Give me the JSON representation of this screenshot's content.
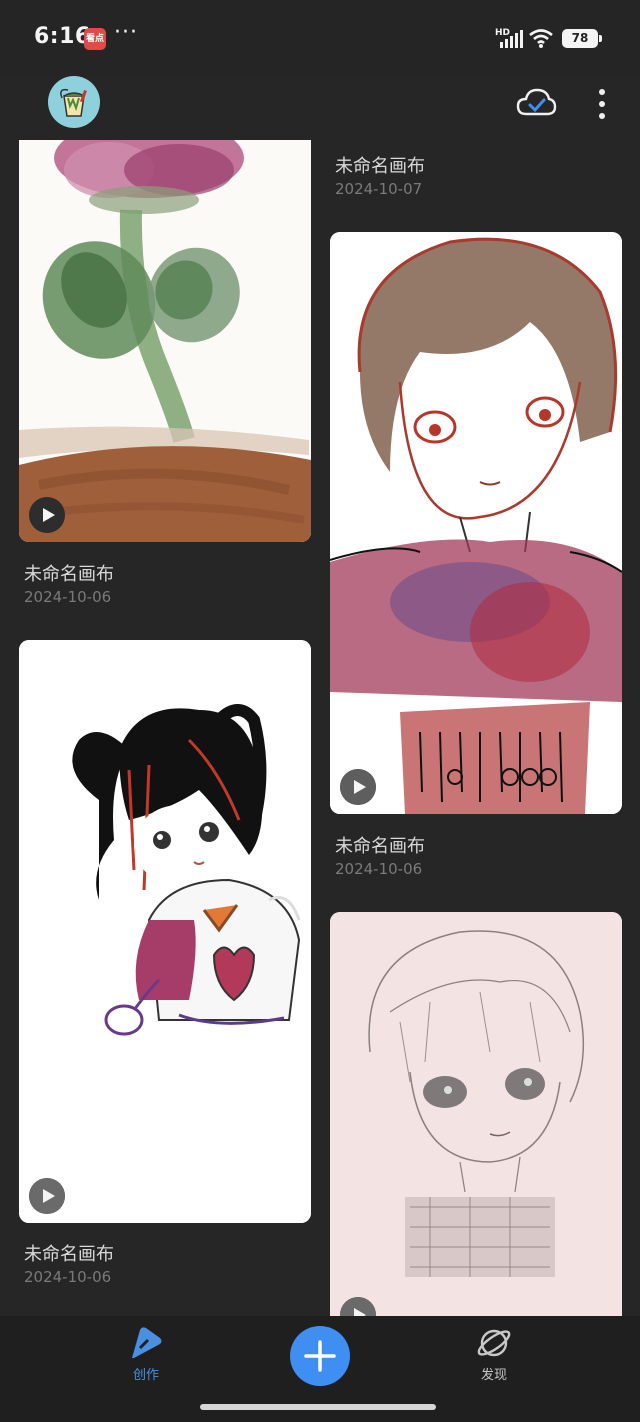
{
  "status_bar": {
    "time": "6:16",
    "app_badge": "看点",
    "more": "···",
    "network": "HD",
    "battery": "78"
  },
  "header": {
    "avatar": "avatar-paint-bucket",
    "cloud_icon": "cloud-sync-check-icon",
    "menu_icon": "more-vertical-icon"
  },
  "artworks": [
    {
      "name": "未命名画布",
      "date": "2024-10-07",
      "thumbnail": "partially-scrolled"
    },
    {
      "name": "未命名画布",
      "date": "2024-10-06",
      "thumbnail": "flower-watercolor"
    },
    {
      "name": "未命名画布",
      "date": "2024-10-06",
      "thumbnail": "boy-brown-hair-watercolor"
    },
    {
      "name": "未命名画布",
      "date": "2024-10-06",
      "thumbnail": "girl-ponytails-heart-shirt"
    },
    {
      "name": "",
      "date": "",
      "thumbnail": "boy-pencil-sketch-pink"
    }
  ],
  "bottom_nav": {
    "create_label": "创作",
    "add_icon": "plus-icon",
    "discover_label": "发现"
  },
  "colors": {
    "background": "#262626",
    "accent": "#3f8ef2",
    "nav_active": "#4a90e2"
  }
}
